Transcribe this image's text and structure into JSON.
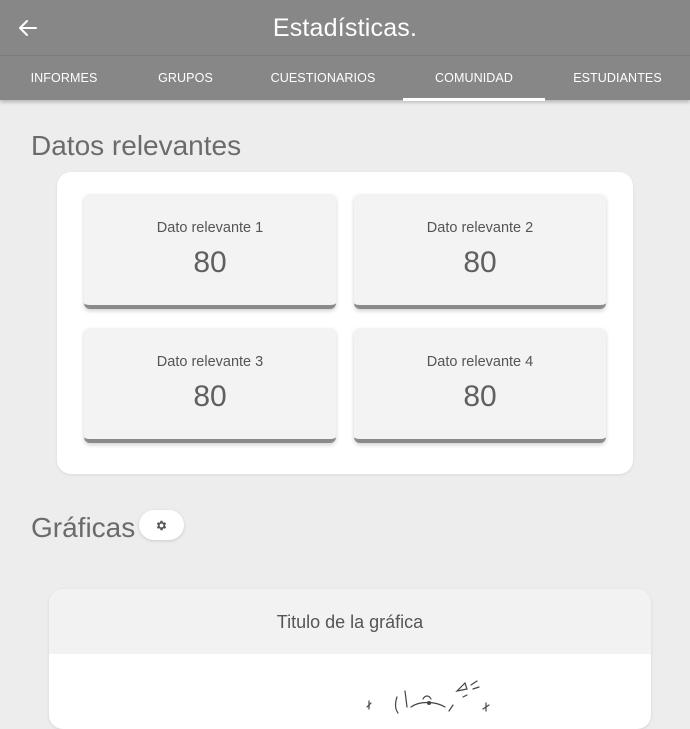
{
  "appbar": {
    "title": "Estadísticas.",
    "back_icon": "arrow-left-icon",
    "color": "#878787"
  },
  "tabs": [
    {
      "label": "INFORMES",
      "active": false
    },
    {
      "label": "GRUPOS",
      "active": false
    },
    {
      "label": "CUESTIONARIOS",
      "active": false
    },
    {
      "label": "COMUNIDAD",
      "active": true
    },
    {
      "label": "ESTUDIANTES",
      "active": false
    }
  ],
  "relevant": {
    "title": "Datos relevantes",
    "cards": [
      {
        "label": "Dato relevante 1",
        "value": "80"
      },
      {
        "label": "Dato relevante 2",
        "value": "80"
      },
      {
        "label": "Dato relevante 3",
        "value": "80"
      },
      {
        "label": "Dato relevante 4",
        "value": "80"
      }
    ]
  },
  "charts": {
    "title": "Gráficas",
    "settings_icon": "gear-icon",
    "chart_title": "Titulo de la gráfica"
  }
}
